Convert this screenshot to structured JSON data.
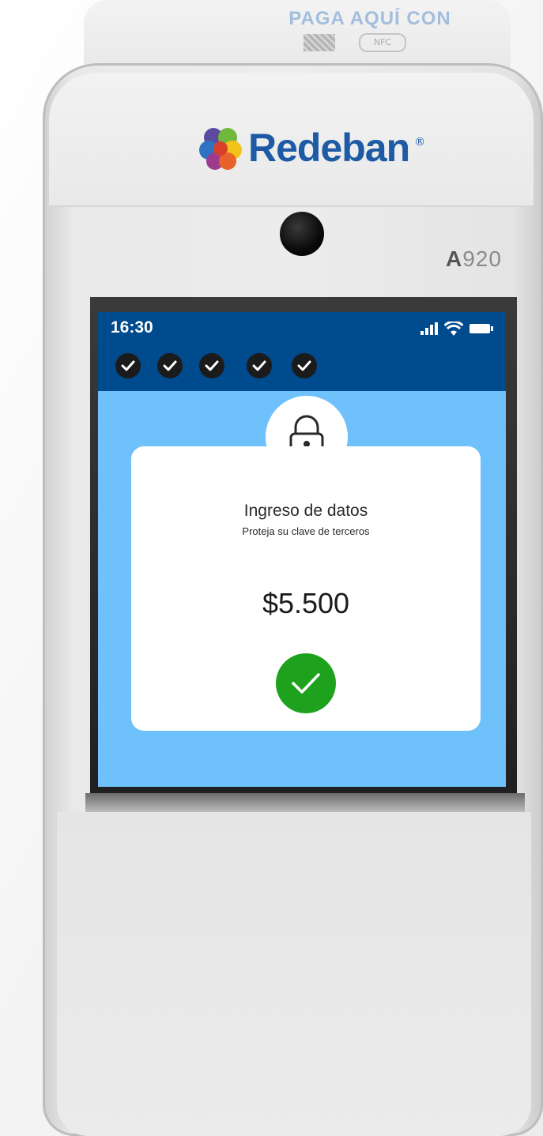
{
  "device": {
    "brand": "Redeban",
    "brand_mark": "®",
    "model_prefix": "A",
    "model_number": "920",
    "cap_text": "PAGA AQUÍ CON",
    "nfc_label": "NFC"
  },
  "status_bar": {
    "time": "16:30",
    "background_color": "#004a8e",
    "icons": [
      "signal-icon",
      "wifi-icon",
      "battery-icon"
    ]
  },
  "steps": {
    "completed": 5,
    "icon": "check-icon"
  },
  "card": {
    "title": "Ingreso de datos",
    "subtitle": "Proteja su clave de terceros",
    "amount": "$5.500",
    "top_icon": "lock-icon",
    "confirm_icon": "check-icon",
    "confirm_color": "#1ea21e"
  },
  "colors": {
    "screen_background": "#6ec1fb",
    "brand_blue": "#1f5aa5"
  }
}
